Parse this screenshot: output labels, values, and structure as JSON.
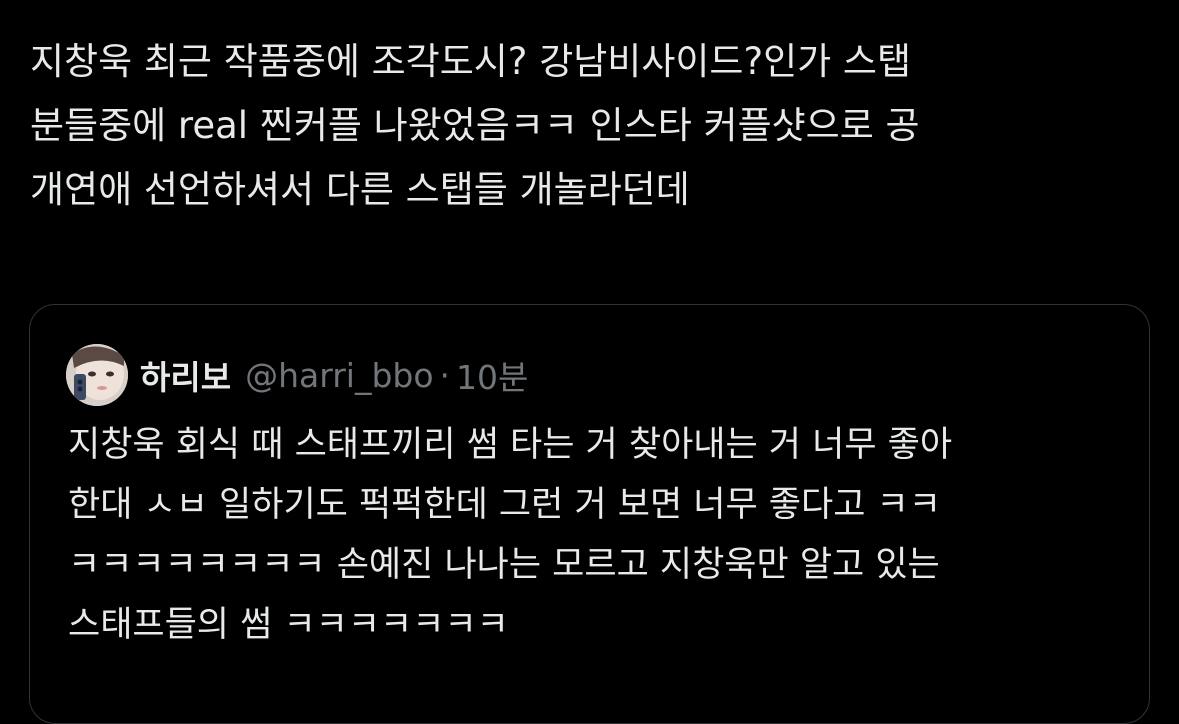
{
  "tweet": {
    "lines": [
      "지창욱 최근 작품중에 조각도시? 강남비사이드?인가 스탭",
      "분들중에 real 찐커플 나왔었음ㅋㅋ 인스타 커플샷으로 공",
      "개연애 선언하셔서 다른 스탭들 개놀라던데"
    ]
  },
  "quote": {
    "display_name": "하리보",
    "handle": "@harri_bbo",
    "separator": "·",
    "time": "10분",
    "lines": [
      "지창욱 회식 때 스태프끼리 썸 타는 거 찾아내는 거 너무 좋아",
      "한대 ㅅㅂ 일하기도 퍽퍽한데 그런 거 보면 너무 좋다고 ㅋㅋ",
      "ㅋㅋㅋㅋㅋㅋㅋㅋ 손예진 나나는 모르고 지창욱만 알고 있는",
      "스태프들의 썸 ㅋㅋㅋㅋㅋㅋㅋ"
    ]
  },
  "colors": {
    "background": "#000000",
    "text": "#e7e9ea",
    "secondary_text": "#71767b",
    "border": "#2f3336"
  },
  "icons": {
    "avatar": "user-avatar-photo"
  }
}
